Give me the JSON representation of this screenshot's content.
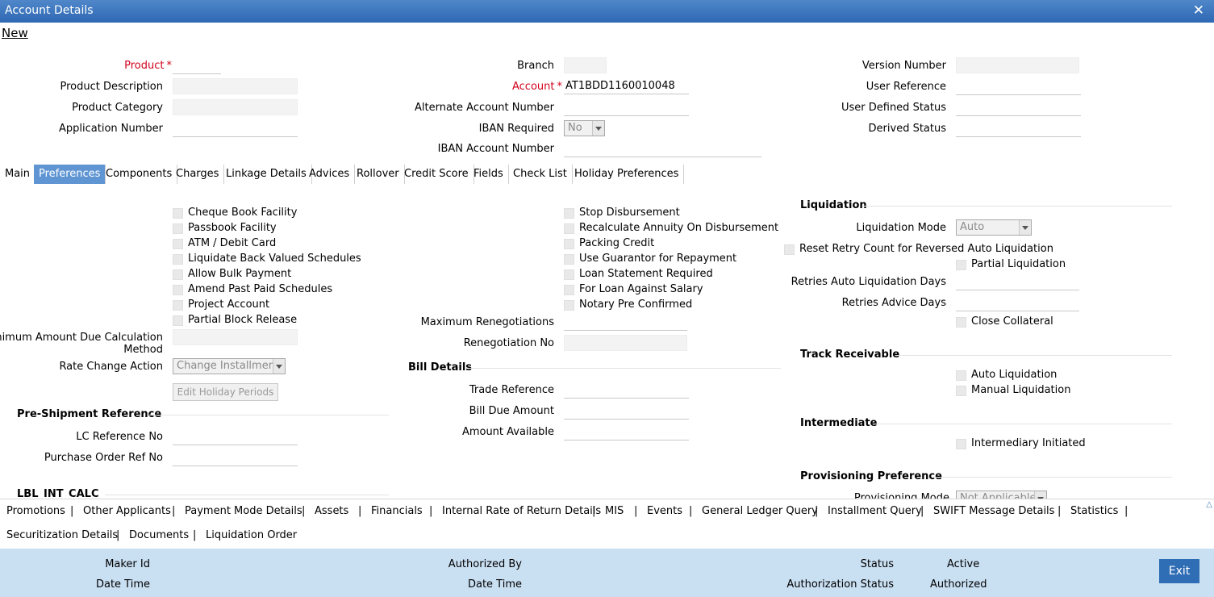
{
  "window": {
    "title": "Account Details"
  },
  "menu": {
    "new_label": "New"
  },
  "header": {
    "product_label": "Product",
    "product_value": "",
    "product_description_label": "Product Description",
    "product_category_label": "Product Category",
    "application_number_label": "Application Number",
    "branch_label": "Branch",
    "account_label": "Account",
    "account_value": "AT1BDD1160010048",
    "alternate_account_label": "Alternate Account Number",
    "iban_required_label": "IBAN Required",
    "iban_required_value": "No",
    "iban_account_label": "IBAN Account Number",
    "version_number_label": "Version Number",
    "user_reference_label": "User Reference",
    "user_defined_status_label": "User Defined Status",
    "derived_status_label": "Derived Status",
    "required_mark": "*"
  },
  "tabs": [
    "Main",
    "Preferences",
    "Components",
    "Charges",
    "Linkage Details",
    "Advices",
    "Rollover",
    "Credit Score",
    "Fields",
    "Check List",
    "Holiday Preferences"
  ],
  "preferences": {
    "left_checks": [
      "Cheque Book Facility",
      "Passbook Facility",
      "ATM / Debit Card",
      "Liquidate Back Valued Schedules",
      "Allow Bulk Payment",
      "Amend Past Paid Schedules",
      "Project Account",
      "Partial Block Release"
    ],
    "min_amount_label_1": "Minimum Amount Due Calculation",
    "min_amount_label_2": "Method",
    "rate_change_label": "Rate Change Action",
    "rate_change_value": "Change Installment",
    "edit_holiday_button": "Edit Holiday Periods",
    "pre_shipment_title": "Pre-Shipment Reference",
    "lc_reference_label": "LC Reference No",
    "purchase_order_label": "Purchase Order Ref No",
    "lbl_int_calc_title": "LBL_INT_CALC",
    "middle_checks": [
      "Stop Disbursement",
      "Recalculate Annuity On Disbursement",
      "Packing Credit",
      "Use Guarantor for Repayment",
      "Loan Statement Required",
      "For Loan Against Salary",
      "Notary Pre Confirmed"
    ],
    "max_renegotiations_label": "Maximum Renegotiations",
    "renegotiation_no_label": "Renegotiation No",
    "bill_details_title": "Bill Details",
    "trade_reference_label": "Trade Reference",
    "bill_due_amount_label": "Bill Due Amount",
    "amount_available_label": "Amount Available",
    "liquidation_title": "Liquidation",
    "liquidation_mode_label": "Liquidation Mode",
    "liquidation_mode_value": "Auto",
    "reset_retry_label": "Reset Retry Count for Reversed Auto Liquidation",
    "partial_liquidation_label": "Partial Liquidation",
    "retries_auto_label": "Retries Auto Liquidation Days",
    "retries_advice_label": "Retries Advice Days",
    "close_collateral_label": "Close Collateral",
    "track_receivable_title": "Track Receivable",
    "auto_liquidation_label": "Auto Liquidation",
    "manual_liquidation_label": "Manual Liquidation",
    "intermediate_title": "Intermediate",
    "intermediary_initiated_label": "Intermediary Initiated",
    "provisioning_title": "Provisioning Preference",
    "provisioning_mode_label": "Provisioning Mode",
    "provisioning_mode_value": "Not Applicable"
  },
  "bottom_links_row1": [
    "Promotions",
    "Other Applicants",
    "Payment Mode Details",
    "Assets",
    "Financials",
    "Internal Rate of Return Details",
    "MIS",
    "Events",
    "General Ledger Query",
    "Installment Query",
    "SWIFT Message Details",
    "Statistics"
  ],
  "bottom_links_row2": [
    "Securitization Details",
    "Documents",
    "Liquidation Order"
  ],
  "separator": "|",
  "footer": {
    "maker_id_label": "Maker Id",
    "date_time_label": "Date Time",
    "authorized_by_label": "Authorized By",
    "status_label": "Status",
    "status_value": "Active",
    "authorization_status_label": "Authorization Status",
    "authorization_status_value": "Authorized",
    "exit_label": "Exit"
  },
  "icons": {
    "close": "close-icon",
    "scroll_up": "scroll-up-icon"
  },
  "colors": {
    "title_bar": "#3a76bd",
    "active_tab": "#5f95d3",
    "footer": "#c9dff2",
    "required": "#d0021b",
    "exit_button": "#2f6db5"
  }
}
